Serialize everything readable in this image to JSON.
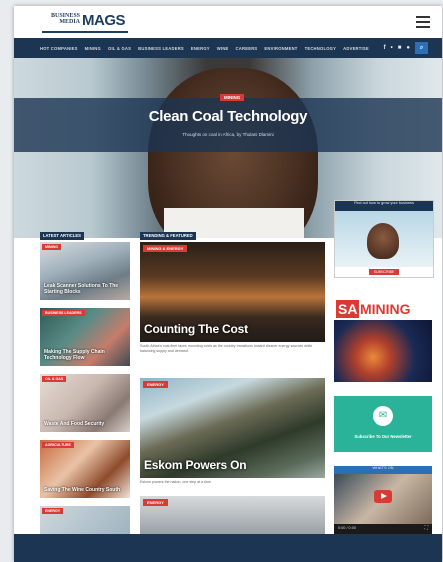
{
  "logo": {
    "small": "BUSINESS MEDIA",
    "big": "MAGS"
  },
  "nav": {
    "items": [
      "HOT COMPANIES",
      "MINING",
      "OIL & GAS",
      "BUSINESS LEADERS",
      "ENERGY",
      "WINE",
      "CAREERS",
      "ENVIRONMENT",
      "TECHNOLOGY",
      "ADVERTISE"
    ],
    "social": [
      "f",
      "•",
      "■",
      "●"
    ],
    "search_icon": "⌕"
  },
  "hero": {
    "tag": "MINING",
    "title": "Clean Coal Technology",
    "byline": "Thoughts on coal in Africa, by Thulani Dlamini"
  },
  "sections": {
    "left_label": "LATEST ARTICLES",
    "mid_label": "TRENDING & FEATURED"
  },
  "left_cards": [
    {
      "tag": "MINING",
      "caption": "Leak Scanner Solutions To The Starting Blocks"
    },
    {
      "tag": "BUSINESS LEADERS",
      "caption": "Making The Supply Chain Technology Flow"
    },
    {
      "tag": "OIL & GAS",
      "caption": "Waste And Food Security"
    },
    {
      "tag": "AGRICULTURE",
      "caption": "Saving The Wine Country South"
    },
    {
      "tag": "ENERGY",
      "caption": ""
    }
  ],
  "mid_cards": [
    {
      "tag": "MINING & ENERGY",
      "headline": "Counting The Cost",
      "excerpt": "South Africa's coal fleet faces mounting costs as the country transitions toward cleaner energy sources while balancing supply and demand."
    },
    {
      "tag": "ENERGY",
      "headline": "Eskom Powers On",
      "excerpt": "Eskom powers the nation, one step at a time."
    },
    {
      "tag": "ENERGY",
      "headline": "",
      "excerpt": ""
    }
  ],
  "ads": {
    "ad1_top": "Find out how to grow your business",
    "ad1_cta": "SUBSCRIBE",
    "saminingSA": "SA",
    "saminingMINING": "MINING",
    "newsletter": "Subscribe To Our Newsletter",
    "video_label": "WHAT'S ON",
    "video_time": "0:00 / 0:00"
  },
  "colors": {
    "navy": "#1c3552",
    "red": "#d83b36",
    "teal": "#2bb39a"
  }
}
